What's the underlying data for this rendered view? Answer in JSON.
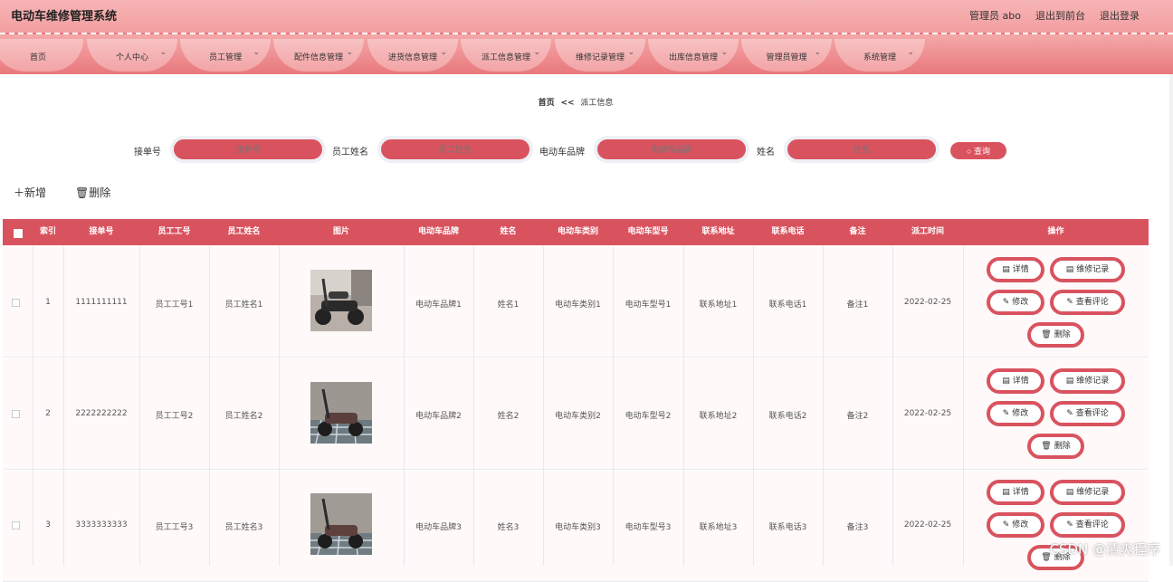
{
  "app": {
    "title": "电动车维修管理系统"
  },
  "header_links": {
    "admin": "管理员 abo",
    "front": "退出到前台",
    "logout": "退出登录"
  },
  "nav": [
    {
      "label": "首页",
      "chev": ""
    },
    {
      "label": "个人中心",
      "chev": "⌄"
    },
    {
      "label": "员工管理",
      "chev": "⌄"
    },
    {
      "label": "配件信息管理",
      "chev": "⌄"
    },
    {
      "label": "进货信息管理",
      "chev": "⌄"
    },
    {
      "label": "派工信息管理",
      "chev": "⌄"
    },
    {
      "label": "维修记录管理",
      "chev": "⌄"
    },
    {
      "label": "出库信息管理",
      "chev": "⌄"
    },
    {
      "label": "管理员管理",
      "chev": "⌄"
    },
    {
      "label": "系统管理",
      "chev": "⌄"
    }
  ],
  "breadcrumb": {
    "home": "首页",
    "sep": "<<",
    "current": "派工信息"
  },
  "search": {
    "order_label": "接单号",
    "order_placeholder": "接单号",
    "emp_label": "员工姓名",
    "emp_placeholder": "员工姓名",
    "brand_label": "电动车品牌",
    "brand_placeholder": "电动车品牌",
    "name_label": "姓名",
    "name_placeholder": "姓名",
    "btn": "查询"
  },
  "toolbar": {
    "add": "新增",
    "delete": "删除"
  },
  "table": {
    "headers": [
      "索引",
      "接单号",
      "员工工号",
      "员工姓名",
      "图片",
      "电动车品牌",
      "姓名",
      "电动车类别",
      "电动车型号",
      "联系地址",
      "联系电话",
      "备注",
      "派工时间",
      "操作"
    ],
    "rows": [
      {
        "index": "1",
        "order": "1111111111",
        "emp_no": "员工工号1",
        "emp_name": "员工姓名1",
        "brand": "电动车品牌1",
        "name": "姓名1",
        "category": "电动车类别1",
        "model": "电动车型号1",
        "address": "联系地址1",
        "phone": "联系电话1",
        "remark": "备注1",
        "time": "2022-02-25"
      },
      {
        "index": "2",
        "order": "2222222222",
        "emp_no": "员工工号2",
        "emp_name": "员工姓名2",
        "brand": "电动车品牌2",
        "name": "姓名2",
        "category": "电动车类别2",
        "model": "电动车型号2",
        "address": "联系地址2",
        "phone": "联系电话2",
        "remark": "备注2",
        "time": "2022-02-25"
      },
      {
        "index": "3",
        "order": "3333333333",
        "emp_no": "员工工号3",
        "emp_name": "员工姓名3",
        "brand": "电动车品牌3",
        "name": "姓名3",
        "category": "电动车类别3",
        "model": "电动车型号3",
        "address": "联系地址3",
        "phone": "联系电话3",
        "remark": "备注3",
        "time": "2022-02-25"
      }
    ],
    "actions": {
      "detail": "详情",
      "repair": "维修记录",
      "edit": "修改",
      "review": "查看评论",
      "delete": "删除"
    }
  },
  "watermark": "CSDN @清爽程序",
  "colors": {
    "accent": "#d9535f",
    "header_bg": "#f4a9aa",
    "nav_tab": "#f8c2c3"
  }
}
